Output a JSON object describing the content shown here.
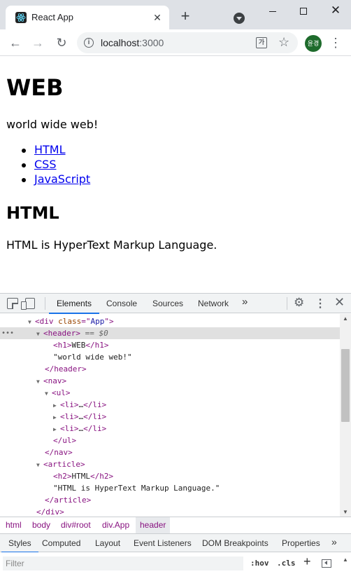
{
  "browser": {
    "tab_title": "React App",
    "tab_close": "✕",
    "new_tab": "+",
    "win_close": "✕",
    "url_host": "localhost",
    "url_port": ":3000",
    "avatar_text": "윤경",
    "menu": "⋮",
    "back": "←",
    "forward": "→",
    "reload": "↻",
    "star": "☆",
    "translate": "가",
    "info": "i"
  },
  "page": {
    "h1": "WEB",
    "subtitle": "world wide web!",
    "links": [
      "HTML",
      "CSS",
      "JavaScript"
    ],
    "h2": "HTML",
    "body": "HTML is HyperText Markup Language."
  },
  "devtools": {
    "tabs": [
      "Elements",
      "Console",
      "Sources",
      "Network"
    ],
    "active_tab": "Elements",
    "more": "»",
    "gear": "⚙",
    "kebab": "⋮",
    "close": "✕",
    "dom_dots": "•••",
    "dom": {
      "div_app": [
        "<div ",
        "class",
        "=\"",
        "App",
        "\">"
      ],
      "header_open": "<header>",
      "header_eq": " == $0",
      "h1": "<h1>",
      "h1_text": "WEB",
      "h1_close": "</h1>",
      "header_text": "\"world wide web!\"",
      "header_close": "</header>",
      "nav_open": "<nav>",
      "ul_open": "<ul>",
      "li_collapsed": [
        "<li>",
        "…",
        "</li>"
      ],
      "ul_close": "</ul>",
      "nav_close": "</nav>",
      "article_open": "<article>",
      "h2": "<h2>",
      "h2_text": "HTML",
      "h2_close": "</h2>",
      "article_text": "\"HTML is HyperText Markup Language.\"",
      "article_close": "</article>",
      "div_close": "</div>"
    },
    "breadcrumbs": [
      "html",
      "body",
      "div#root",
      "div.App",
      "header"
    ],
    "subtabs": [
      "Styles",
      "Computed",
      "Layout",
      "Event Listeners",
      "DOM Breakpoints",
      "Properties"
    ],
    "subtabs_more": "»",
    "filter_placeholder": "Filter",
    "hov": ":hov",
    "cls": ".cls",
    "plus": "+"
  }
}
